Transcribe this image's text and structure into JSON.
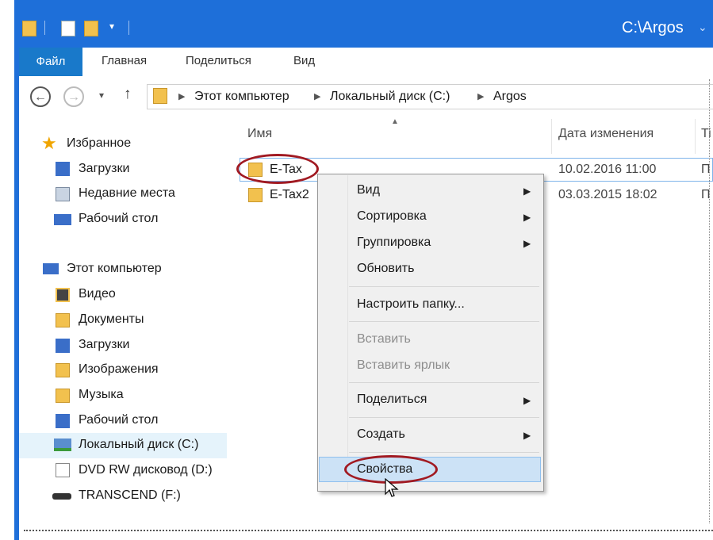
{
  "window": {
    "title": "C:\\Argos"
  },
  "ribbon": {
    "tabs": [
      "Файл",
      "Главная",
      "Поделиться",
      "Вид"
    ]
  },
  "address": {
    "crumbs": [
      "Этот компьютер",
      "Локальный диск (C:)",
      "Argos"
    ]
  },
  "nav": {
    "favorites_header": "Избранное",
    "favorites": [
      "Загрузки",
      "Недавние места",
      "Рабочий стол"
    ],
    "computer_header": "Этот компьютер",
    "computer": [
      "Видео",
      "Документы",
      "Загрузки",
      "Изображения",
      "Музыка",
      "Рабочий стол",
      "Локальный диск (C:)",
      "DVD RW дисковод (D:)",
      "TRANSCEND (F:)"
    ]
  },
  "columns": {
    "name": "Имя",
    "date": "Дата изменения",
    "type": "Ti"
  },
  "files": [
    {
      "name": "E-Tax",
      "date": "10.02.2016 11:00",
      "type": "П"
    },
    {
      "name": "E-Tax2",
      "date": "03.03.2015 18:02",
      "type": "П"
    }
  ],
  "context_menu": {
    "view": "Вид",
    "sort": "Сортировка",
    "group": "Группировка",
    "refresh": "Обновить",
    "customize": "Настроить папку...",
    "paste": "Вставить",
    "paste_shortcut": "Вставить ярлык",
    "share": "Поделиться",
    "create": "Создать",
    "properties": "Свойства"
  },
  "colors": {
    "accent": "#1e6fd9",
    "highlight_ring": "#a11a22",
    "menu_hover": "#cce2f6"
  }
}
